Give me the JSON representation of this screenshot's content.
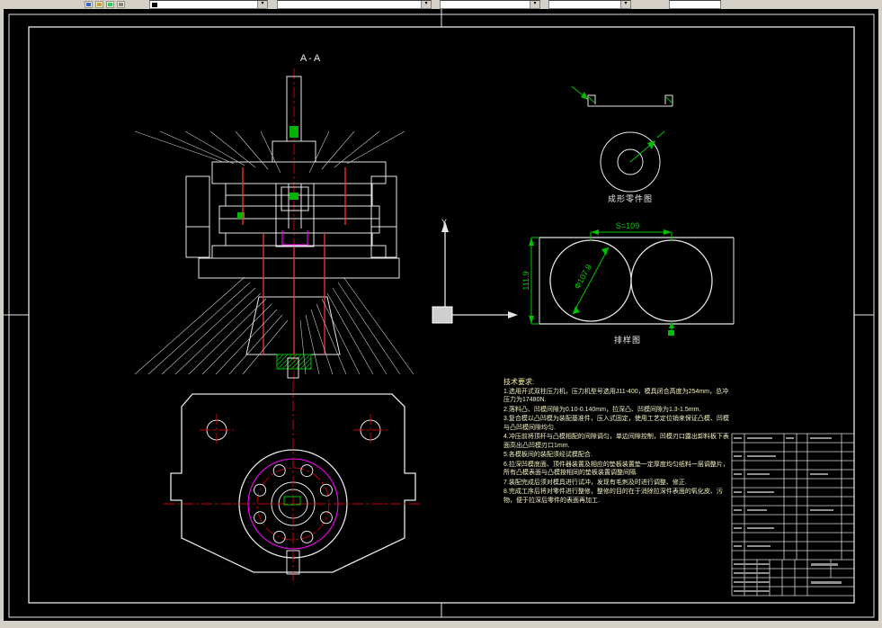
{
  "toolbar": {
    "note": ""
  },
  "drawing": {
    "section_label": "A-A",
    "ucs_y_label": "Y",
    "part_figure_caption": "成形零件图",
    "strip_caption": "排样图",
    "strip_dims": {
      "step": "S=109",
      "width": "111.9",
      "diameter": "Φ107.8"
    }
  },
  "tech": {
    "title": "技术要求:",
    "items": [
      "1.选用开式双柱压力机，压力机型号选用J11-400，模具闭合高度为254mm，总冲压力为17480N.",
      "2.落料凸、凹模间隙为0.10-0.140mm，拉深凸、凹模间隙为1.3-1.5mm.",
      "3.复合模以凸凹模为装配基准件，压入式固定，使用工艺定位销来保证凸模、凹模与凸凹模间隙均匀.",
      "4.冲压前将顶杆与凸模相配的间隙调匀，单边间隙控制，凹模刃口露出卸料板下表面高出凸凹模刃口1mm.",
      "5.各模板间的装配须经试模配合.",
      "6.拉深凹模底面、顶件器装置及相应的垫板装置垫一定厚度均匀纸料一层调整片，所有凸模表面与凸模按相同的垫板装置调整间隔.",
      "7.装配完成后须对模具进行试冲，发现有毛刺及时进行调整、修正.",
      "8.完成工序后将对零件进行整修，整修的目的在于消除拉深件表面的氧化皮、污物，便于拉深后零件的表面再加工."
    ]
  },
  "colors": {
    "canvas_bg": "#000000",
    "frame": "#ffffff",
    "centerline_red": "#d40000",
    "dimension_green": "#00c800",
    "highlight_magenta": "#ff00ff",
    "hatch_blue": "#3c46ff",
    "hatch_cyan": "#00b8b8",
    "toolbar_bg": "#d4d0c8"
  }
}
